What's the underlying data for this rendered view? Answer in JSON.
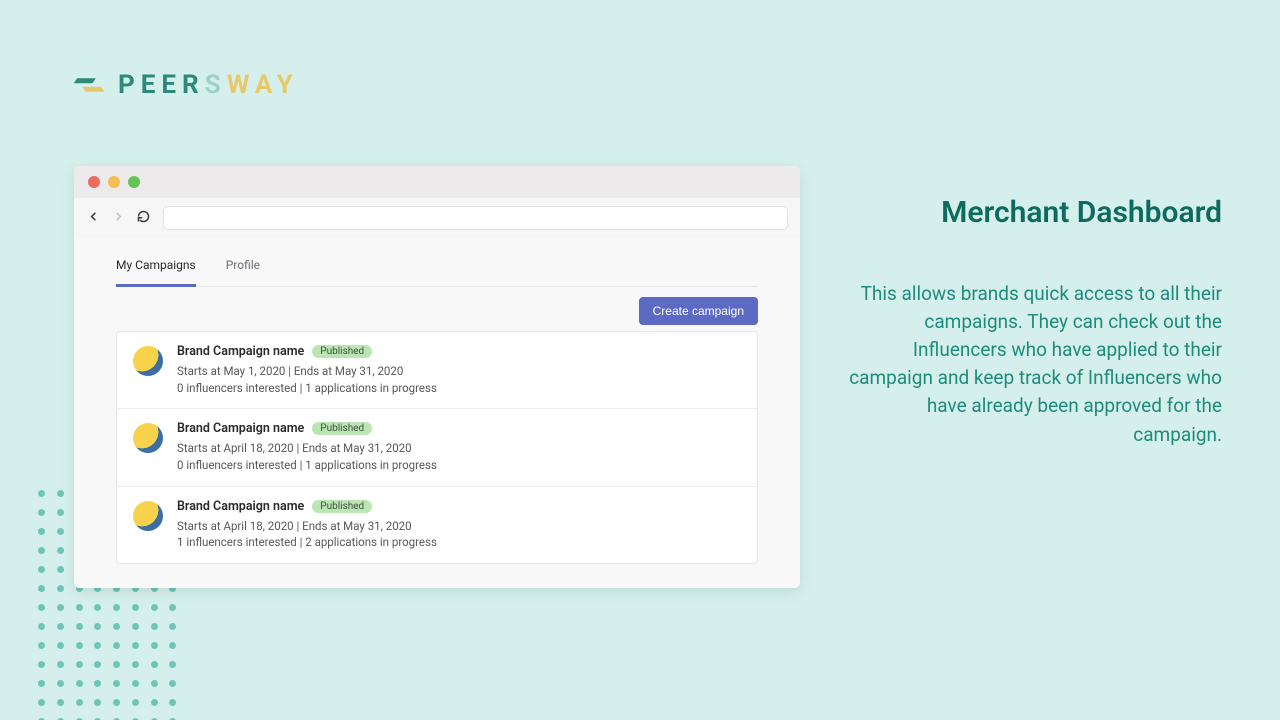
{
  "logo": {
    "peer": "PEER",
    "s": "S",
    "way": "WAY"
  },
  "side": {
    "title": "Merchant Dashboard",
    "body": "This allows brands quick access to all their campaigns. They can check out the Influencers who have applied to their campaign and keep track of Influencers who have already been approved for the campaign."
  },
  "browser": {
    "tabs": [
      {
        "label": "My Campaigns",
        "active": true
      },
      {
        "label": "Profile",
        "active": false
      }
    ],
    "create_label": "Create campaign",
    "campaigns": [
      {
        "name": "Brand Campaign name",
        "status": "Published",
        "dates": "Starts at May 1, 2020 | Ends at May 31, 2020",
        "meta": "0 influencers interested | 1 applications in progress"
      },
      {
        "name": "Brand Campaign name",
        "status": "Published",
        "dates": "Starts at April 18, 2020 | Ends at May 31, 2020",
        "meta": "0 influencers interested | 1 applications in progress"
      },
      {
        "name": "Brand Campaign name",
        "status": "Published",
        "dates": "Starts at April 18, 2020 | Ends at May 31, 2020",
        "meta": "1 influencers interested | 2 applications in progress"
      }
    ]
  }
}
